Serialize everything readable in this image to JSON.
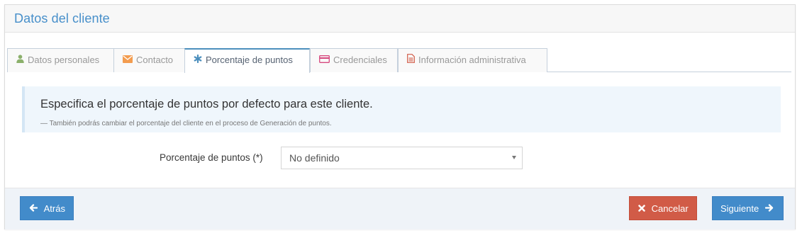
{
  "panel": {
    "title": "Datos del cliente"
  },
  "tabs": [
    {
      "label": "Datos personales",
      "icon": "user-icon",
      "color": "#8bb06b"
    },
    {
      "label": "Contacto",
      "icon": "envelope-icon",
      "color": "#f39c4f"
    },
    {
      "label": "Porcentaje de puntos",
      "icon": "asterisk-icon",
      "color": "#4c8fbd",
      "active": true
    },
    {
      "label": "Credenciales",
      "icon": "credit-card-icon",
      "color": "#d6487e"
    },
    {
      "label": "Información administrativa",
      "icon": "file-text-icon",
      "color": "#d15b47"
    }
  ],
  "alert": {
    "title": "Especifica el porcentaje de puntos por defecto para este cliente.",
    "note": "— También podrás cambiar el porcentaje del cliente en el proceso de Generación de puntos."
  },
  "form": {
    "label": "Porcentaje de puntos (*)",
    "select_value": "No definido"
  },
  "footer": {
    "back_label": "Atrás",
    "cancel_label": "Cancelar",
    "next_label": "Siguiente"
  },
  "colors": {
    "primary": "#428bca",
    "danger": "#d15b47",
    "title": "#478fca"
  }
}
